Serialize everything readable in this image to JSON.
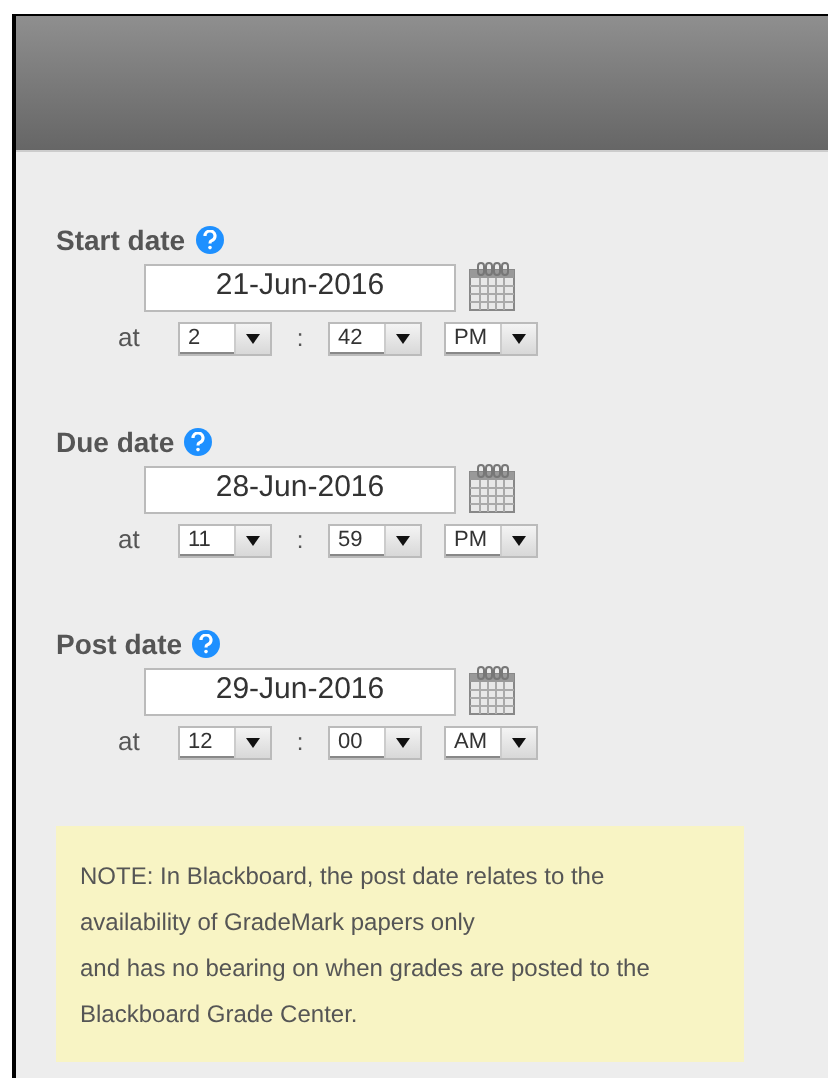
{
  "dates": [
    {
      "label": "Start date",
      "date": "21-Jun-2016",
      "at": "at",
      "hour": "2",
      "separator": ":",
      "minute": "42",
      "ampm": "PM"
    },
    {
      "label": "Due date",
      "date": "28-Jun-2016",
      "at": "at",
      "hour": "11",
      "separator": ":",
      "minute": "59",
      "ampm": "PM"
    },
    {
      "label": "Post date",
      "date": "29-Jun-2016",
      "at": "at",
      "hour": "12",
      "separator": ":",
      "minute": "00",
      "ampm": "AM"
    }
  ],
  "note": {
    "lines": [
      "NOTE: In Blackboard, the post date relates to the",
      "availability of GradeMark papers only",
      "and has no bearing on when grades are posted to the",
      "Blackboard Grade Center."
    ]
  }
}
